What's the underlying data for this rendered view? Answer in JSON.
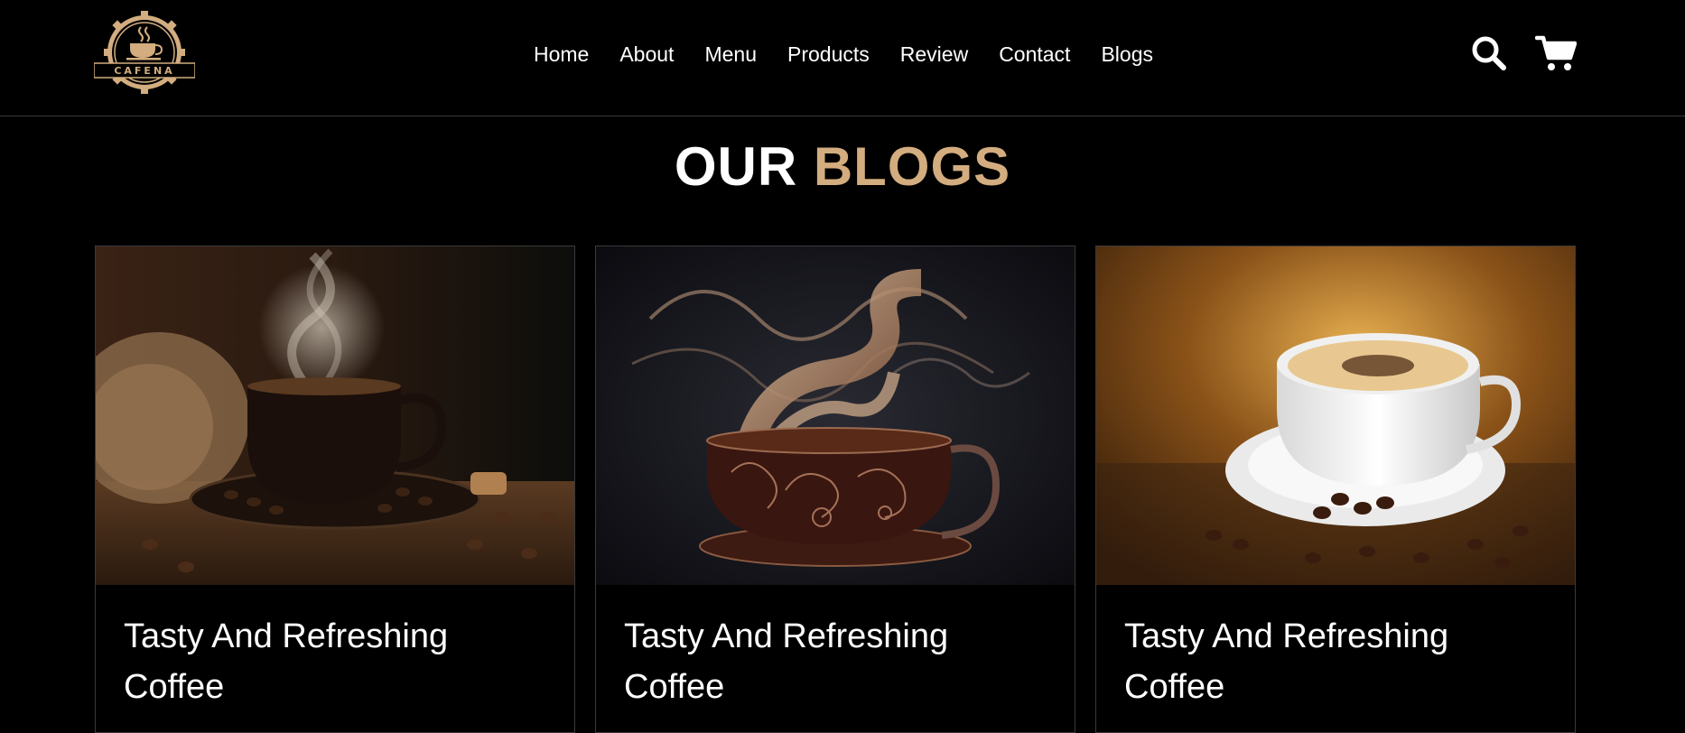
{
  "brand": {
    "logo_text": "CAFENA"
  },
  "nav": {
    "items": [
      {
        "label": "Home"
      },
      {
        "label": "About"
      },
      {
        "label": "Menu"
      },
      {
        "label": "Products"
      },
      {
        "label": "Review"
      },
      {
        "label": "Contact"
      },
      {
        "label": "Blogs"
      }
    ]
  },
  "header_icons": {
    "search": "search-icon",
    "cart": "cart-icon"
  },
  "section": {
    "title_main": "OUR",
    "title_accent": "BLOGS"
  },
  "blogs": [
    {
      "title": "Tasty And Refreshing Coffee",
      "image": "coffee-cup-beans-steam"
    },
    {
      "title": "Tasty And Refreshing Coffee",
      "image": "ornate-cup-swirling-smoke"
    },
    {
      "title": "Tasty And Refreshing Coffee",
      "image": "white-cappuccino-cup"
    }
  ],
  "colors": {
    "accent": "#d3ad7f",
    "background": "#000000",
    "border": "#3a3a3a"
  }
}
